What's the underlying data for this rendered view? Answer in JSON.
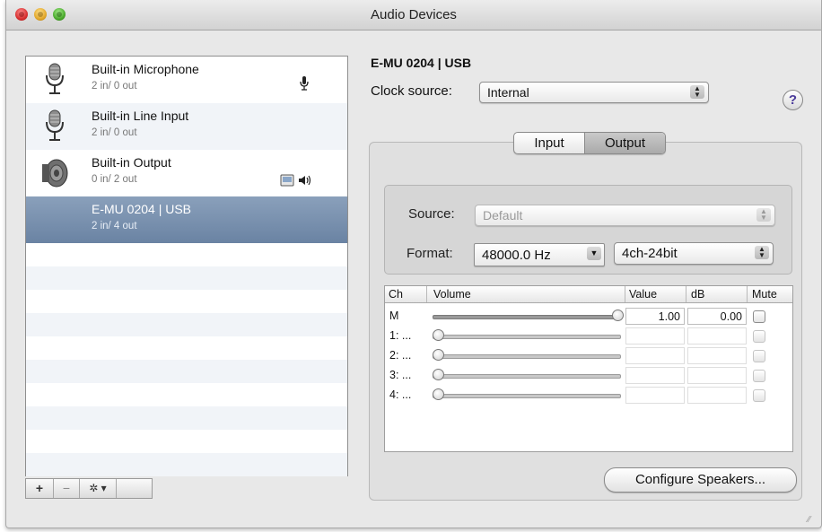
{
  "window": {
    "title": "Audio Devices"
  },
  "devices": [
    {
      "name": "Built-in Microphone",
      "io": "2 in/ 0 out",
      "icon": "microphone-icon",
      "status_icon": "microphone-status-icon"
    },
    {
      "name": "Built-in Line Input",
      "io": "2 in/ 0 out",
      "icon": "microphone-icon"
    },
    {
      "name": "Built-in Output",
      "io": "0 in/ 2 out",
      "icon": "speaker-icon",
      "status_icon": "finder-speaker-status-icon"
    },
    {
      "name": "E-MU 0204 | USB",
      "io": "2 in/ 4 out",
      "selected": true
    }
  ],
  "list_toolbar": {
    "add": "+",
    "remove": "−",
    "action": "✲ ▾"
  },
  "detail": {
    "device_title": "E-MU 0204 | USB",
    "clock_label": "Clock source:",
    "clock_value": "Internal",
    "help": "?"
  },
  "tabs": {
    "input": "Input",
    "output": "Output",
    "active": "output"
  },
  "stream": {
    "source_label": "Source:",
    "source_value": "Default",
    "format_label": "Format:",
    "format_rate": "48000.0 Hz",
    "format_bits": "4ch-24bit"
  },
  "channel_table": {
    "headers": {
      "ch": "Ch",
      "volume": "Volume",
      "value": "Value",
      "db": "dB",
      "mute": "Mute"
    },
    "rows": [
      {
        "ch": "M",
        "level": 1.0,
        "value": "1.00",
        "db": "0.00",
        "mute": false
      },
      {
        "ch": "1: ...",
        "level": 0.0,
        "value": "",
        "db": "",
        "mute": false
      },
      {
        "ch": "2: ...",
        "level": 0.0,
        "value": "",
        "db": "",
        "mute": false
      },
      {
        "ch": "3: ...",
        "level": 0.0,
        "value": "",
        "db": "",
        "mute": false
      },
      {
        "ch": "4: ...",
        "level": 0.0,
        "value": "",
        "db": "",
        "mute": false
      }
    ]
  },
  "configure_button": "Configure Speakers..."
}
